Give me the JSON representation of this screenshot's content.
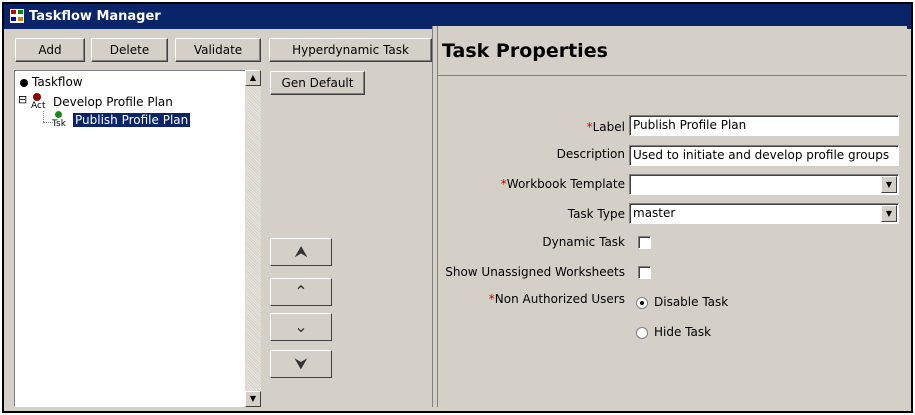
{
  "window": {
    "title": "Taskflow Manager"
  },
  "toolbar": {
    "add_label": "Add",
    "delete_label": "Delete",
    "validate_label": "Validate",
    "hyperdynamic_label": "Hyperdynamic Task"
  },
  "tree": {
    "root": "Taskflow",
    "activity_badge": "Act",
    "activity": "Develop Profile Plan",
    "task_badge": "Tsk",
    "task": "Publish Profile Plan",
    "expand_glyph": "⊟"
  },
  "middle": {
    "gen_default_label": "Gen Default",
    "move_top_glyph": "⮝",
    "move_up_glyph": "⌃",
    "move_down_glyph": "⌄",
    "move_bottom_glyph": "⮟"
  },
  "properties": {
    "title": "Task Properties",
    "required_mark": "*",
    "label_label": "Label",
    "label_value": "Publish Profile Plan",
    "description_label": "Description",
    "description_value": "Used to initiate and develop profile groups",
    "workbook_label": "Workbook Template",
    "workbook_value": "",
    "tasktype_label": "Task Type",
    "tasktype_value": "master",
    "dynamic_label": "Dynamic Task",
    "dynamic_checked": false,
    "unassigned_label": "Show Unassigned Worksheets",
    "unassigned_checked": false,
    "nonauth_label": "Non Authorized Users",
    "nonauth_options": [
      "Disable Task",
      "Hide Task"
    ],
    "nonauth_selected": "Disable Task"
  },
  "colors": {
    "titlebar": "#0a246a",
    "required": "#d00000",
    "selection": "#0a246a",
    "activity_icon": "#8b0000",
    "task_icon": "#1a8a1a"
  },
  "icons": {
    "app": "taskflow-app-icon",
    "root": "bullet-icon",
    "activity": "activity-icon",
    "task": "task-icon"
  }
}
